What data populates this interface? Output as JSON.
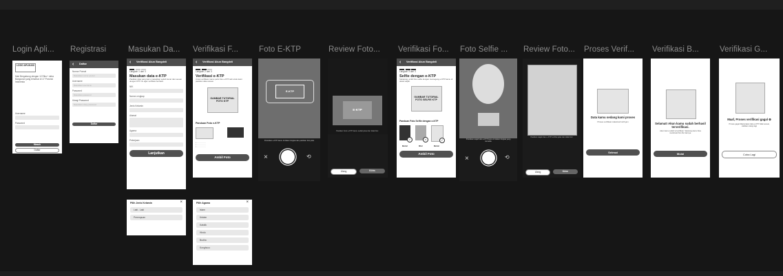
{
  "frames": [
    {
      "title": "Login Apli..."
    },
    {
      "title": "Registrasi"
    },
    {
      "title": "Masukan Da..."
    },
    {
      "title": "Verifikasi  F..."
    },
    {
      "title": "Foto E-KTP"
    },
    {
      "title": "Review Foto..."
    },
    {
      "title": "Verifikasi Fo..."
    },
    {
      "title": "Foto Selfie ..."
    },
    {
      "title": "Review Foto..."
    },
    {
      "title": "Proses Verif..."
    },
    {
      "title": "Verifikasi B..."
    },
    {
      "title": "Verifikasi G..."
    }
  ],
  "login": {
    "logo": "LOGO APLIKASI",
    "intro": "Mari Bergabung dengan 12 Ribu+ mitra Bangunan yang tersebar di 17 Provinsi Indonesia",
    "username_label": "Username",
    "password_label": "Password",
    "masuk": "Masuk",
    "daftar": "Daftar"
  },
  "registrasi": {
    "header": "Daftar",
    "labels": [
      "Nomor Ponsel",
      "Username",
      "Password",
      "Ulangi Password"
    ],
    "placeholders": [
      "Masukkan nomor ponsel",
      "Masukkan username",
      "Masukkan password",
      "Masukkan ulang password"
    ],
    "button": "Daftar"
  },
  "data": {
    "header": "Verifikasi Akun Bangdeli",
    "step": "Langkah 1 dari 3",
    "title": "Masukan data e-KTP",
    "desc": "Pastikan data yang kamu masukkan sudah benar dan sesuai dengan KTP mu agar verifikasi berhasil.",
    "fields": [
      "NIK",
      "Nama Lengkap",
      "Jenis Kelamin",
      "Alamat",
      "Agama",
      "Pekerjaan"
    ],
    "button": "Lanjutkan"
  },
  "fotoktp": {
    "header": "Verifikasi Akun Bangdeli",
    "step": "Langkah 2 dari 3",
    "title": "Verifikasi e-KTP",
    "desc": "Untuk verifikasi, kamu perlu foto e-KTP asli untuk kami pastikan data sesuai.",
    "tutorial": "GAMBAR TUTORIAL FOTO KTP",
    "panduan": "Panduan Foto e-KTP",
    "button": "Ambil Foto"
  },
  "camera_ktp": {
    "frame": "E-KTP",
    "hint": "Posisikan e-KTP kamu di dalam bingkai dan pastikan foto jelas"
  },
  "review_ktp": {
    "card": "E-KTP",
    "hint": "Pastikan Foto e-KTP kamu sudah jelas dan tidak blur.",
    "ulang": "Ulang",
    "kirim": "Kirim"
  },
  "selfie": {
    "header": "Verifikasi Akun Bangdeli",
    "step": "Langkah 3 dari 3",
    "title": "Selfie dengan e-KTP",
    "desc": "Sekarang, ambil foto selfie dengan memegang e-KTP kamu di dekat wajah.",
    "tutorial": "GAMBAR TUTORIAL FOTO SELFIE KTP",
    "panduan": "Panduan Foto Selfie dengan e-KTP",
    "labels": [
      "Benar",
      "Blur",
      "Benar"
    ],
    "button": "Ambil Foto"
  },
  "camera_selfie": {
    "hint": "Posisikan wajah dan e-KTP kamu di dalam bingkai yang tersedia"
  },
  "review_selfie": {
    "hint": "Pastikan wajah dan e-KTP terlihat jelas dan tidak blur",
    "ulang": "Ulang",
    "kirim": "Kirim"
  },
  "proses": {
    "title": "Data kamu sedang kami proses",
    "desc": "Proses verifikasi maksimal 1x24 jam",
    "button": "Selesai"
  },
  "berhasil": {
    "title": "Selamat! Akun kamu sudah berhasil terverifikasi.",
    "desc": "Akun kamu sudah terverifikasi. Sekarang kamu bisa menikmati fitur-fitur lainnya.",
    "button": "Mulai"
  },
  "gagal": {
    "title": "Maaf, Proses verifikasi gagal",
    "desc": "Proses gagal dikarenakan data e-KTP tidak sesuai, silahkan ulangi lagi",
    "button": "Coba Lagi"
  },
  "popup_gender": {
    "title": "Pilih Jenis Kelamin",
    "options": [
      "Laki - Laki",
      "Perempuan"
    ]
  },
  "popup_agama": {
    "title": "Pilih Agama",
    "options": [
      "Islam",
      "Kristen",
      "Katolik",
      "Hindu",
      "Budha",
      "Konghucu"
    ]
  }
}
